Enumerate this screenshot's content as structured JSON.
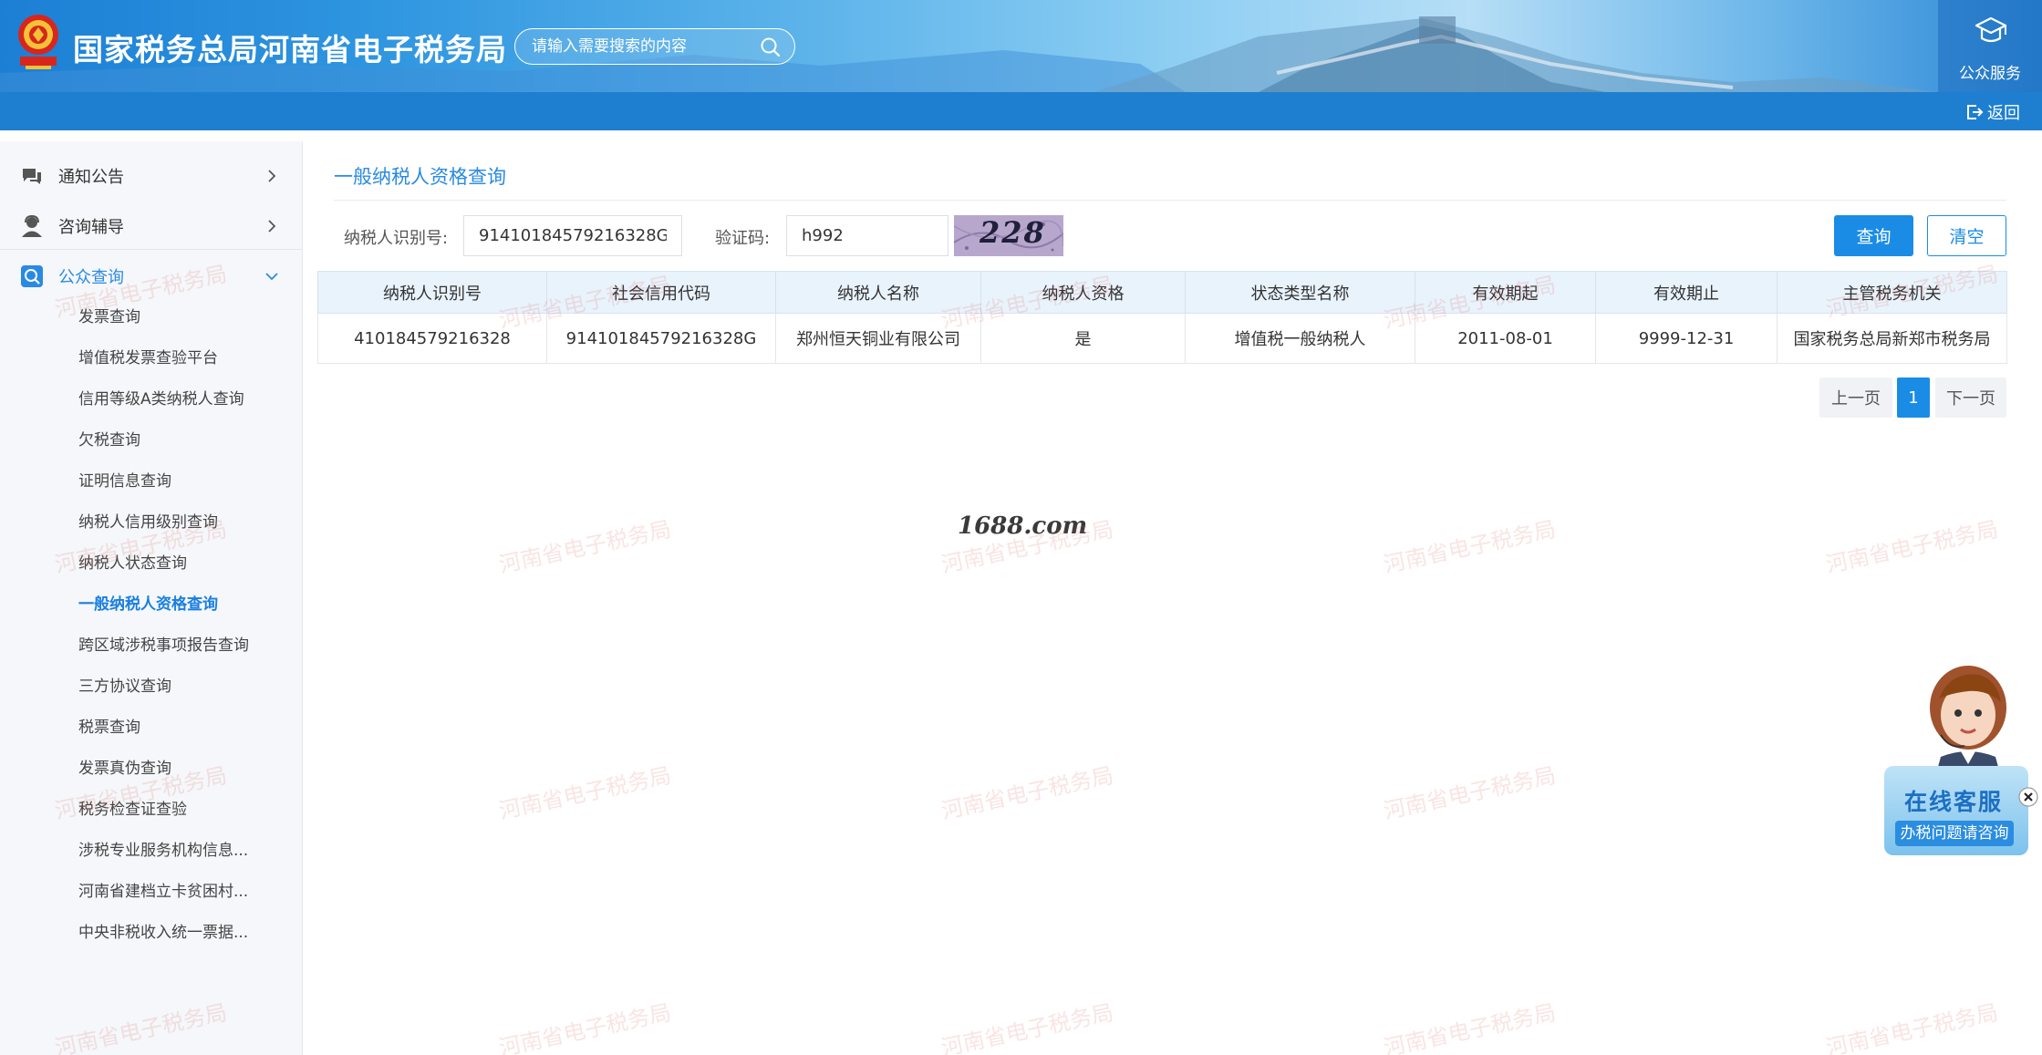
{
  "header": {
    "site_title": "国家税务总局河南省电子税务局",
    "search_placeholder": "请输入需要搜索的内容",
    "public_service_label": "公众服务",
    "back_label": "返回"
  },
  "sidebar": {
    "groups": [
      {
        "label": "通知公告",
        "icon": "message-icon"
      },
      {
        "label": "咨询辅导",
        "icon": "consult-user-icon"
      },
      {
        "label": "公众查询",
        "icon": "search-query-icon"
      }
    ],
    "sub_items": [
      "发票查询",
      "增值税发票查验平台",
      "信用等级A类纳税人查询",
      "欠税查询",
      "证明信息查询",
      "纳税人信用级别查询",
      "纳税人状态查询",
      "一般纳税人资格查询",
      "跨区域涉税事项报告查询",
      "三方协议查询",
      "税票查询",
      "发票真伪查询",
      "税务检查证查验",
      "涉税专业服务机构信息...",
      "河南省建档立卡贫困村...",
      "中央非税收入统一票据..."
    ],
    "active_sub_item": "一般纳税人资格查询"
  },
  "main": {
    "title": "一般纳税人资格查询",
    "form": {
      "taxpayer_id_label": "纳税人识别号:",
      "taxpayer_id_value": "91410184579216328G",
      "captcha_label": "验证码:",
      "captcha_value": "h992",
      "captcha_image_text": "228",
      "query_button": "查询",
      "clear_button": "清空"
    },
    "table": {
      "headers": [
        "纳税人识别号",
        "社会信用代码",
        "纳税人名称",
        "纳税人资格",
        "状态类型名称",
        "有效期起",
        "有效期止",
        "主管税务机关"
      ],
      "rows": [
        [
          "410184579216328",
          "91410184579216328G",
          "郑州恒天铜业有限公司",
          "是",
          "增值税一般纳税人",
          "2011-08-01",
          "9999-12-31",
          "国家税务总局新郑市税务局"
        ]
      ]
    },
    "pagination": {
      "prev": "上一页",
      "current": "1",
      "next": "下一页"
    }
  },
  "watermark": {
    "site": "1688.com",
    "overlay": "河南省电子税务局"
  },
  "online_service": {
    "title": "在线客服",
    "subtitle": "办税问题请咨询"
  },
  "colors": {
    "primary": "#1a8ce6",
    "header_bar": "#1e7fd0",
    "active_text": "#2a8ae2",
    "table_header_bg": "#e9f3fc"
  }
}
